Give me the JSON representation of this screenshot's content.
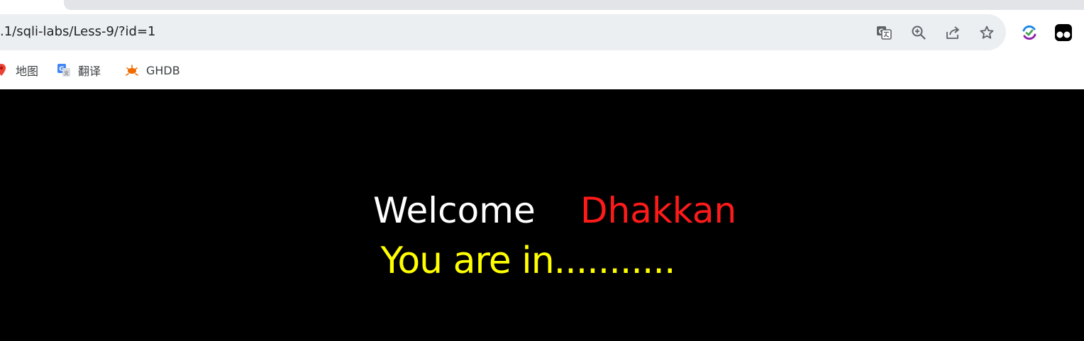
{
  "browser": {
    "url": ".1/sqli-labs/Less-9/?id=1",
    "bookmarks": [
      {
        "label": "地图",
        "icon": "map-pin-icon"
      },
      {
        "label": "翻译",
        "icon": "google-translate-icon"
      },
      {
        "label": "GHDB",
        "icon": "ghdb-icon"
      }
    ],
    "omnibox_icons": [
      "translate-icon",
      "zoom-icon",
      "share-icon",
      "bookmark-star-icon"
    ],
    "extensions": [
      "sync-extension-icon",
      "tampermonkey-icon"
    ]
  },
  "page": {
    "welcome_text": "Welcome",
    "username": "Dhakkan",
    "status_text": "You are in...........",
    "colors": {
      "background": "#000000",
      "welcome": "#ffffff",
      "username": "#ff0000",
      "status": "#ffff00"
    }
  }
}
